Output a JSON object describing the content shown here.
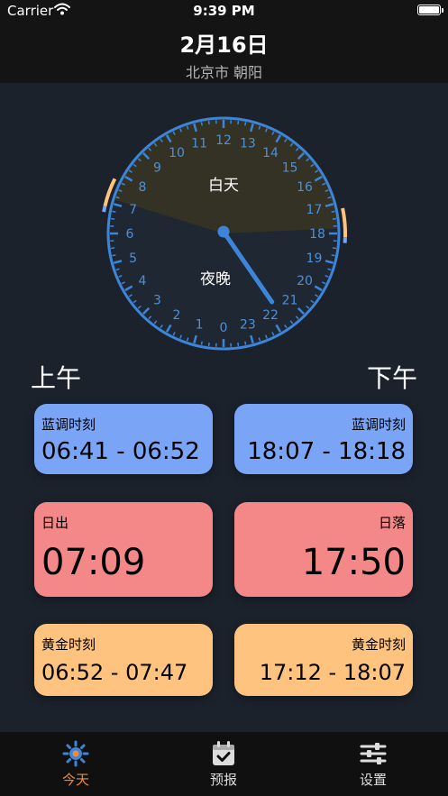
{
  "status_bar": {
    "carrier": "Carrier",
    "time": "9:39 PM"
  },
  "header": {
    "date": "2月16日",
    "location": "北京市 朝阳"
  },
  "clock": {
    "hour_numbers": [
      "0",
      "1",
      "2",
      "3",
      "4",
      "5",
      "6",
      "7",
      "8",
      "9",
      "10",
      "11",
      "12",
      "13",
      "14",
      "15",
      "16",
      "17",
      "18",
      "19",
      "20",
      "21",
      "22",
      "23"
    ],
    "day_label": "白天",
    "night_label": "夜晚",
    "current_time_hours": 21.65,
    "sunrise_hours": 7.15,
    "sunset_hours": 17.83,
    "colors": {
      "day": "#343225",
      "night": "#1f2733",
      "ring": "#3c85d8",
      "blue_hour": "#7aa5f7",
      "golden_hour": "#fec47f"
    }
  },
  "sections": {
    "am": "上午",
    "pm": "下午"
  },
  "cards": {
    "am_blue": {
      "title": "蓝调时刻",
      "value": "06:41 - 06:52"
    },
    "pm_blue": {
      "title": "蓝调时刻",
      "value": "18:07 - 18:18"
    },
    "sunrise": {
      "title": "日出",
      "value": "07:09"
    },
    "sunset": {
      "title": "日落",
      "value": "17:50"
    },
    "am_golden": {
      "title": "黄金时刻",
      "value": "06:52 - 07:47"
    },
    "pm_golden": {
      "title": "黄金时刻",
      "value": "17:12 - 18:07"
    }
  },
  "tabs": [
    {
      "label": "今天",
      "icon": "sun-icon",
      "active": true
    },
    {
      "label": "预报",
      "icon": "calendar-check-icon",
      "active": false
    },
    {
      "label": "设置",
      "icon": "sliders-icon",
      "active": false
    }
  ]
}
